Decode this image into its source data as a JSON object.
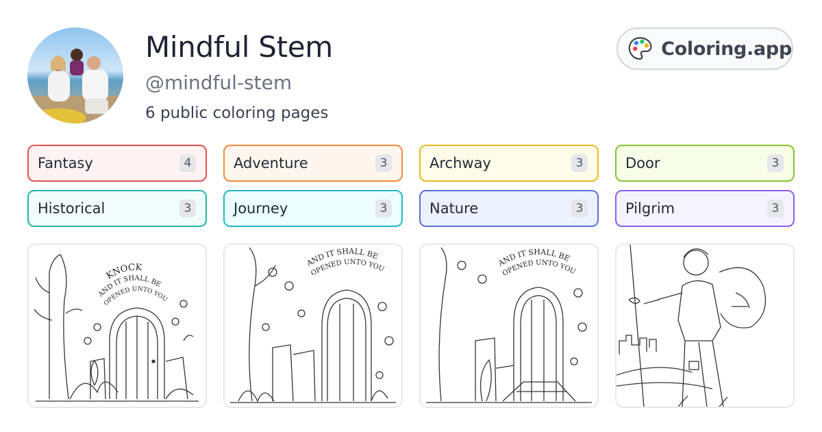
{
  "profile": {
    "name": "Mindful Stem",
    "handle": "@mindful-stem",
    "page_count_text": "6 public coloring pages"
  },
  "brand": {
    "label": "Coloring.app",
    "icon": "palette-icon"
  },
  "tags": [
    {
      "label": "Fantasy",
      "count": "4",
      "border": "#e05252",
      "bg": "#fef2f2"
    },
    {
      "label": "Adventure",
      "count": "3",
      "border": "#f08a3c",
      "bg": "#fff7ed"
    },
    {
      "label": "Archway",
      "count": "3",
      "border": "#e8b820",
      "bg": "#fefce8"
    },
    {
      "label": "Door",
      "count": "3",
      "border": "#86c232",
      "bg": "#f7fee7"
    },
    {
      "label": "Historical",
      "count": "3",
      "border": "#1fb5ac",
      "bg": "#f0fdfa"
    },
    {
      "label": "Journey",
      "count": "3",
      "border": "#22b8c8",
      "bg": "#ecfeff"
    },
    {
      "label": "Nature",
      "count": "3",
      "border": "#5b6fd8",
      "bg": "#eef2ff"
    },
    {
      "label": "Pilgrim",
      "count": "3",
      "border": "#8b5cf6",
      "bg": "#f5f3ff"
    }
  ],
  "cards": [
    {
      "image": "doorway-knock-coloring-page",
      "caption": [
        "KNOCK",
        "AND IT SHALL BE",
        "OPENED UNTO YOU"
      ]
    },
    {
      "image": "ivy-archway-door-coloring-page",
      "caption": [
        "AND IT SHALL BE",
        "OPENED UNTO YOU"
      ]
    },
    {
      "image": "stone-archway-door-coloring-page",
      "caption": [
        "AND IT SHALL BE",
        "OPENED UNTO YOU"
      ]
    },
    {
      "image": "pilgrim-traveler-coloring-page",
      "caption": []
    }
  ]
}
